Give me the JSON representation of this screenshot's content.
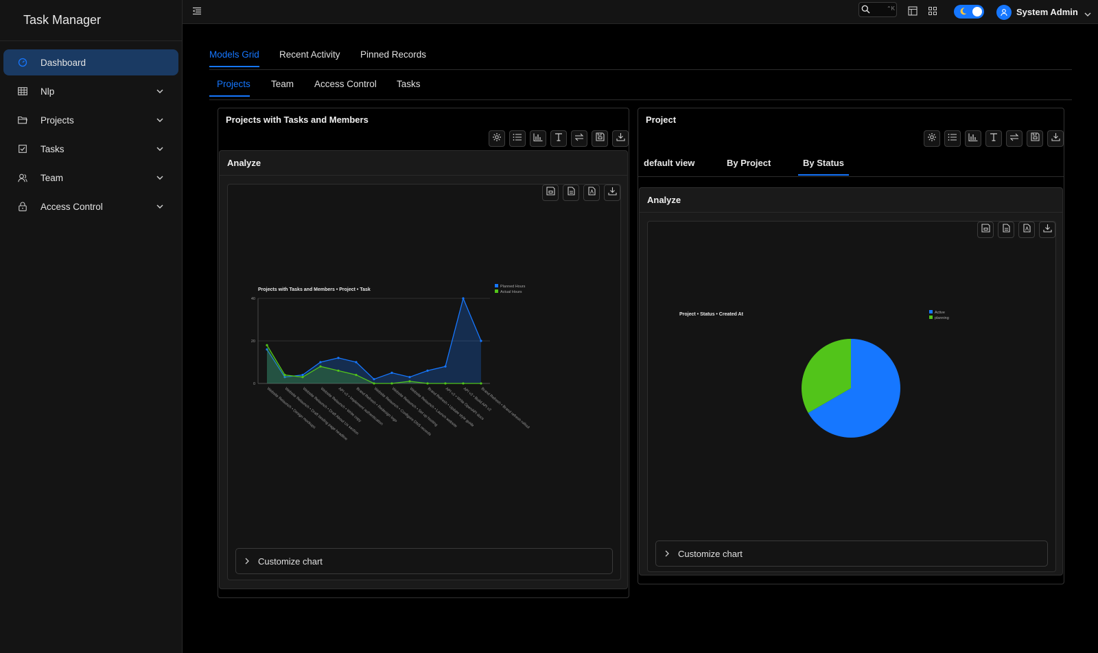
{
  "app": {
    "title": "Task Manager"
  },
  "sidebar": {
    "items": [
      {
        "label": "Dashboard",
        "icon": "dashboard-icon",
        "active": true
      },
      {
        "label": "Nlp",
        "icon": "table-icon",
        "expandable": true
      },
      {
        "label": "Projects",
        "icon": "folder-icon",
        "expandable": true
      },
      {
        "label": "Tasks",
        "icon": "checkbox-icon",
        "expandable": true
      },
      {
        "label": "Team",
        "icon": "team-icon",
        "expandable": true
      },
      {
        "label": "Access Control",
        "icon": "lock-icon",
        "expandable": true
      }
    ]
  },
  "topbar": {
    "search_shortcut": "⌃K",
    "user_name": "System Admin"
  },
  "tabs": {
    "primary": [
      "Models Grid",
      "Recent Activity",
      "Pinned Records"
    ],
    "primary_active": "Models Grid",
    "secondary": [
      "Projects",
      "Team",
      "Access Control",
      "Tasks"
    ],
    "secondary_active": "Projects"
  },
  "left_card": {
    "title": "Projects with Tasks and Members",
    "analyze_label": "Analyze",
    "customize_label": "Customize chart"
  },
  "right_card": {
    "title": "Project",
    "view_tabs": [
      "default view",
      "By Project",
      "By Status"
    ],
    "view_active": "By Status",
    "analyze_label": "Analyze",
    "customize_label": "Customize chart"
  },
  "colors": {
    "accent": "#1677ff",
    "green": "#52c41a",
    "active_nav_bg": "#1a3a63"
  },
  "chart_data": [
    {
      "type": "area",
      "title": "Projects with Tasks and Members • Project • Task",
      "ylim": [
        0,
        40
      ],
      "yticks": [
        0,
        20,
        40
      ],
      "legend_position": "top-right",
      "categories": [
        "Website Relaunch • Design mockups",
        "Website Relaunch • Draft landing page headline",
        "Website Relaunch • Draft About Us section",
        "Website Relaunch • Write copy",
        "API v2 • Implement authentication",
        "Brand Refresh • Redesign logo",
        "Website Relaunch • Configure DNS records",
        "Website Relaunch • Set up hosting",
        "Website Relaunch • Launch website",
        "Brand Refresh • Update style guide",
        "API v2 • Write OpenAPI docs",
        "API v2 • Build API v2",
        "Brand Refresh • Brand refresh rollout"
      ],
      "series": [
        {
          "name": "Planned Hours",
          "color": "#1677ff",
          "values": [
            16,
            3,
            4,
            10,
            12,
            10,
            2,
            5,
            3,
            6,
            8,
            40,
            20
          ]
        },
        {
          "name": "Actual Hours",
          "color": "#52c41a",
          "values": [
            18,
            4,
            3,
            8,
            6,
            4,
            0,
            0,
            1,
            0,
            0,
            0,
            0
          ]
        }
      ]
    },
    {
      "type": "pie",
      "title": "Project • Status • Created At",
      "legend_position": "top-right",
      "slices": [
        {
          "name": "Active",
          "value": 2,
          "color": "#1677ff"
        },
        {
          "name": "planning",
          "value": 1,
          "color": "#52c41a"
        }
      ]
    }
  ]
}
